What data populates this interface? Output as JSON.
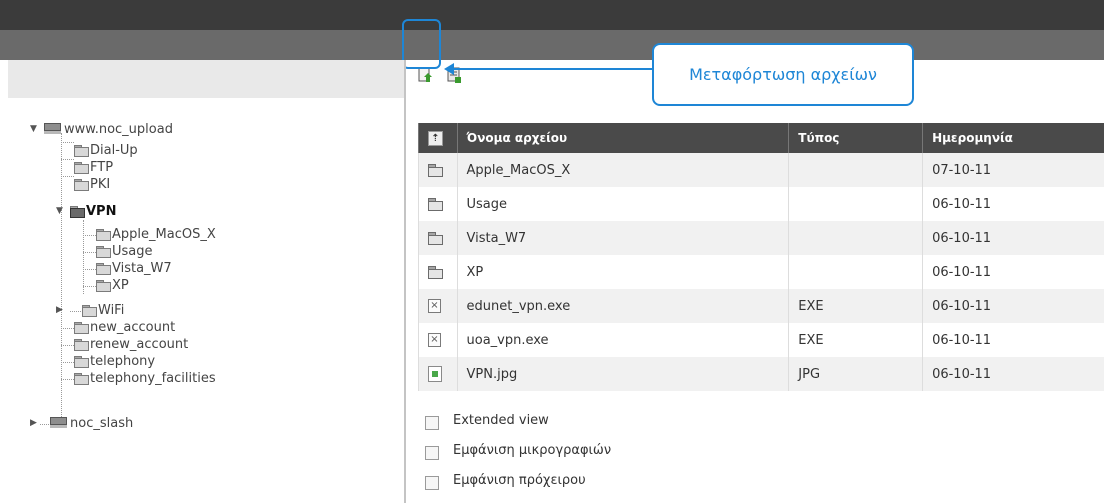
{
  "toolbar": {
    "icons": [
      "refresh-icon",
      "upload-file-icon",
      "new-file-icon"
    ]
  },
  "annotation": {
    "callout_text": "Μεταφόρτωση αρχείων",
    "color": "#1e86d6"
  },
  "tree": {
    "nodes": [
      {
        "id": "root1",
        "label": "www.noc_upload",
        "icon": "server-icon",
        "expander": "▼"
      },
      {
        "id": "dialup",
        "label": "Dial-Up",
        "icon": "folder-icon"
      },
      {
        "id": "ftp",
        "label": "FTP",
        "icon": "folder-icon"
      },
      {
        "id": "pki",
        "label": "PKI",
        "icon": "folder-icon"
      },
      {
        "id": "vpn",
        "label": "VPN",
        "icon": "folder-open-icon",
        "expander": "▼",
        "selected": true
      },
      {
        "id": "apple",
        "label": "Apple_MacOS_X",
        "icon": "folder-icon"
      },
      {
        "id": "usage",
        "label": "Usage",
        "icon": "folder-icon"
      },
      {
        "id": "vista",
        "label": "Vista_W7",
        "icon": "folder-icon"
      },
      {
        "id": "xp",
        "label": "XP",
        "icon": "folder-icon"
      },
      {
        "id": "wifi",
        "label": "WiFi",
        "icon": "folder-icon",
        "expander": "▶"
      },
      {
        "id": "newacc",
        "label": "new_account",
        "icon": "folder-icon"
      },
      {
        "id": "renewacc",
        "label": "renew_account",
        "icon": "folder-icon"
      },
      {
        "id": "tel",
        "label": "telephony",
        "icon": "folder-icon"
      },
      {
        "id": "telfac",
        "label": "telephony_facilities",
        "icon": "folder-icon"
      },
      {
        "id": "root2",
        "label": "noc_slash",
        "icon": "server-icon",
        "expander": "▶"
      }
    ]
  },
  "table": {
    "headers": {
      "sort": "⇡",
      "name": "Όνομα αρχείου",
      "type": "Τύπος",
      "date": "Ημερομηνία"
    },
    "rows": [
      {
        "icon": "folder-icon",
        "name": "Apple_MacOS_X",
        "type": "",
        "date": "07-10-11"
      },
      {
        "icon": "folder-icon",
        "name": "Usage",
        "type": "",
        "date": "06-10-11"
      },
      {
        "icon": "folder-icon",
        "name": "Vista_W7",
        "type": "",
        "date": "06-10-11"
      },
      {
        "icon": "folder-icon",
        "name": "XP",
        "type": "",
        "date": "06-10-11"
      },
      {
        "icon": "exe-file-icon",
        "name": "edunet_vpn.exe",
        "type": "EXE",
        "date": "06-10-11"
      },
      {
        "icon": "exe-file-icon",
        "name": "uoa_vpn.exe",
        "type": "EXE",
        "date": "06-10-11"
      },
      {
        "icon": "image-file-icon",
        "name": "VPN.jpg",
        "type": "JPG",
        "date": "06-10-11"
      }
    ]
  },
  "options": [
    {
      "label": "Extended view",
      "checked": false
    },
    {
      "label": "Εμφάνιση μικρογραφιών",
      "checked": false
    },
    {
      "label": "Εμφάνιση πρόχειρου",
      "checked": false
    }
  ]
}
